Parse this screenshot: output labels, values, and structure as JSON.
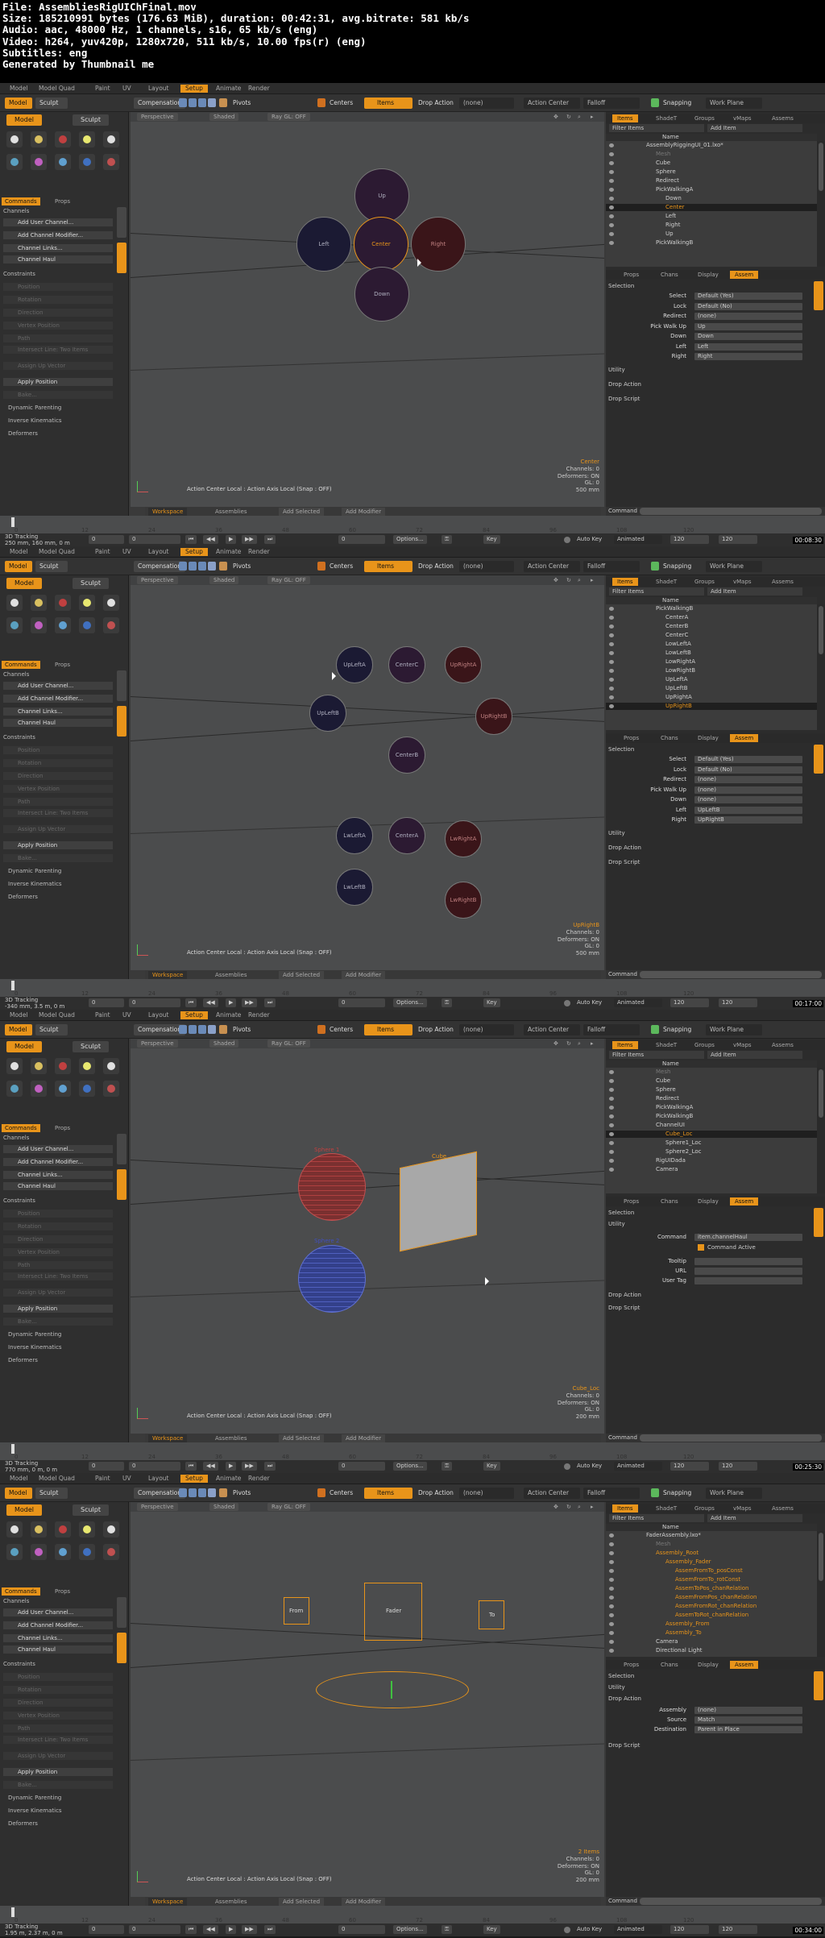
{
  "file_info": {
    "line1": "File: AssembliesRigUIChFinal.mov",
    "line2": "Size: 185210991 bytes (176.63 MiB), duration: 00:42:31, avg.bitrate: 581 kb/s",
    "line3": "Audio: aac, 48000 Hz, 1 channels, s16, 65 kb/s (eng)",
    "line4": "Video: h264, yuv420p, 1280x720, 511 kb/s, 10.00 fps(r) (eng)",
    "line5": "Subtitles: eng",
    "line6": "Generated by Thumbnail me"
  },
  "ui": {
    "tabs": [
      "Model",
      "Model Quad",
      "Paint",
      "UV",
      "Layout",
      "Setup",
      "Animate",
      "Render"
    ],
    "active_tab": "Setup",
    "toolbar": {
      "compensation": "Compensation",
      "pivots": "Pivots",
      "centers": "Centers",
      "items": "Items",
      "drop_action": "Drop Action",
      "none": "(none)",
      "action_center": "Action Center",
      "falloff": "Falloff",
      "snapping": "Snapping",
      "work_plane": "Work Plane"
    },
    "modes": {
      "model": "Model",
      "sculpt": "Sculpt"
    },
    "left_tabs": {
      "commands": "Commands",
      "props": "Props"
    },
    "side_tabs": {
      "setup": "Setup",
      "modifiers": "Modifiers"
    },
    "left_panel": {
      "channels": "Channels",
      "add_user_channel": "Add User Channel...",
      "add_channel_modifier": "Add Channel Modifier...",
      "channel_links": "Channel Links...",
      "channel_haul": "Channel Haul",
      "constraints": "Constraints",
      "position": "Position",
      "rotation": "Rotation",
      "direction": "Direction",
      "vertex_position": "Vertex Position",
      "path": "Path",
      "intersect_line": "Intersect Line: Two Items",
      "assign_up_vector": "Assign Up Vector",
      "apply_position": "Apply Position",
      "bake": "Bake...",
      "dynamic_parenting": "Dynamic Parenting",
      "inverse_kinematics": "Inverse Kinematics",
      "deformers": "Deformers"
    },
    "viewport_head": {
      "perspective": "Perspective",
      "shaded": "Shaded",
      "raygl": "Ray GL: OFF"
    },
    "status_line": "Action Center Local : Action Axis Local (Snap : OFF)",
    "workspace_bar": {
      "workspace": "Workspace",
      "assemblies": "Assemblies",
      "add_selected": "Add Selected",
      "add_modifier": "Add Modifier",
      "drop_hint": "Drag & Drop Items or Channels into the Workspace"
    },
    "right_tabs": [
      "Items",
      "ShadeT",
      "Groups",
      "vMaps",
      "Assems"
    ],
    "filter_items": "Filter Items",
    "add_item": "Add Item",
    "name_col": "Name",
    "props_tabs": [
      "Props",
      "Chans",
      "Display",
      "Assem"
    ],
    "side_assembly": "Assembly",
    "side_settings": "Settings",
    "command_label": "Command",
    "sections": {
      "selection": "Selection",
      "utility": "Utility",
      "drop_action": "Drop Action",
      "drop_script": "Drop Script"
    },
    "timeline_ticks": [
      "0",
      "12",
      "24",
      "36",
      "48",
      "60",
      "72",
      "84",
      "96",
      "108",
      "120"
    ],
    "playbar": {
      "tracking": "3D Tracking",
      "options": "Options...",
      "key": "Key",
      "auto_key": "Auto Key",
      "animated": "Animated",
      "zero": "0",
      "end1": "120",
      "end2": "120"
    }
  },
  "frames": [
    {
      "timestamp": "00:08:30",
      "distance": "250 mm, 160 mm, 0 m",
      "info": {
        "name": "Center",
        "channels": "Channels: 0",
        "deformers": "Deformers: ON",
        "gl": "GL: 0",
        "size": "500 mm"
      },
      "nodes": [
        {
          "label": "Up",
          "style": "p"
        },
        {
          "label": "Left",
          "style": "b"
        },
        {
          "label": "Center",
          "style": "p"
        },
        {
          "label": "Right",
          "style": "r"
        },
        {
          "label": "Down",
          "style": "p"
        }
      ],
      "tree": [
        "AssemblyRiggingUI_01.lxo*",
        "Mesh",
        "Cube",
        "Sphere",
        "Redirect",
        "PickWalkingA",
        "Down",
        "Center",
        "Left",
        "Right",
        "Up",
        "PickWalkingB"
      ],
      "fields": [
        {
          "label": "Select",
          "value": "Default (Yes)"
        },
        {
          "label": "Lock",
          "value": "Default (No)"
        },
        {
          "label": "Redirect",
          "value": "(none)"
        },
        {
          "label": "Pick Walk Up",
          "value": "Up"
        },
        {
          "label": "Down",
          "value": "Down"
        },
        {
          "label": "Left",
          "value": "Left"
        },
        {
          "label": "Right",
          "value": "Right"
        }
      ]
    },
    {
      "timestamp": "00:17:00",
      "distance": "-340 mm, 3.5 m, 0 m",
      "info": {
        "name": "UpRightB",
        "channels": "Channels: 0",
        "deformers": "Deformers: ON",
        "gl": "GL: 0",
        "size": "500 mm"
      },
      "nodes": [
        {
          "label": "UpLeftA",
          "style": "b"
        },
        {
          "label": "CenterC",
          "style": "p"
        },
        {
          "label": "UpRightA",
          "style": "r"
        },
        {
          "label": "UpLeftB",
          "style": "b"
        },
        {
          "label": "UpRightB",
          "style": "r"
        },
        {
          "label": "CenterB",
          "style": "p"
        },
        {
          "label": "LwLeftA",
          "style": "b"
        },
        {
          "label": "CenterA",
          "style": "p"
        },
        {
          "label": "LwRightA",
          "style": "r"
        },
        {
          "label": "LwLeftB",
          "style": "b"
        },
        {
          "label": "LwRightB",
          "style": "r"
        }
      ],
      "tree": [
        "PickWalkingB",
        "CenterA",
        "CenterB",
        "CenterC",
        "LowLeftA",
        "LowLeftB",
        "LowRightA",
        "LowRightB",
        "UpLeftA",
        "UpLeftB",
        "UpRightA",
        "UpRightB"
      ],
      "fields": [
        {
          "label": "Select",
          "value": "Default (Yes)"
        },
        {
          "label": "Lock",
          "value": "Default (No)"
        },
        {
          "label": "Redirect",
          "value": "(none)"
        },
        {
          "label": "Pick Walk Up",
          "value": "(none)"
        },
        {
          "label": "Down",
          "value": "(none)"
        },
        {
          "label": "Left",
          "value": "UpLeftB"
        },
        {
          "label": "Right",
          "value": "UpRightB"
        }
      ]
    },
    {
      "timestamp": "00:25:30",
      "distance": "770 mm, 0 m, 0 m",
      "info": {
        "name": "Cube_Loc",
        "channels": "Channels: 0",
        "deformers": "Deformers: ON",
        "gl": "GL: 0",
        "size": "200 mm"
      },
      "objects": {
        "sphere1": "Sphere 1",
        "sphere2": "Sphere 2",
        "cube": "Cube"
      },
      "tree": [
        "Mesh",
        "Cube",
        "Sphere",
        "Redirect",
        "PickWalkingA",
        "PickWalkingB",
        "ChannelUI",
        "Cube_Loc",
        "Sphere1_Loc",
        "Sphere2_Loc",
        "RigUIDada",
        "Camera"
      ],
      "utility": {
        "command_label": "Command",
        "command_value": "item.channelHaul",
        "command_active": "Command Active",
        "tooltip": "Tooltip",
        "url": "URL",
        "user_tag": "User Tag"
      }
    },
    {
      "timestamp": "00:34:00",
      "distance": "1.95 m, 2.37 m, 0 m",
      "info": {
        "name": "2 Items",
        "channels": "Channels: 0",
        "deformers": "Deformers: ON",
        "gl": "GL: 0",
        "size": "200 mm"
      },
      "objects": {
        "from": "From",
        "fader": "Fader",
        "to": "To"
      },
      "tree": [
        "FaderAssembly.lxo*",
        "Mesh",
        "Assembly_Root",
        "Assembly_Fader",
        "AssemFromTo_posConst",
        "AssemFromTo_rotConst",
        "AssemToPos_chanRelation",
        "AssemFromPos_chanRelation",
        "AssemFromRot_chanRelation",
        "AssemToRot_chanRelation",
        "Assembly_From",
        "Assembly_To",
        "Camera",
        "Directional Light"
      ],
      "fields": [
        {
          "label": "Assembly",
          "value": "(none)"
        },
        {
          "label": "Source",
          "value": "Match"
        },
        {
          "label": "Destination",
          "value": "Parent in Place"
        }
      ]
    }
  ]
}
